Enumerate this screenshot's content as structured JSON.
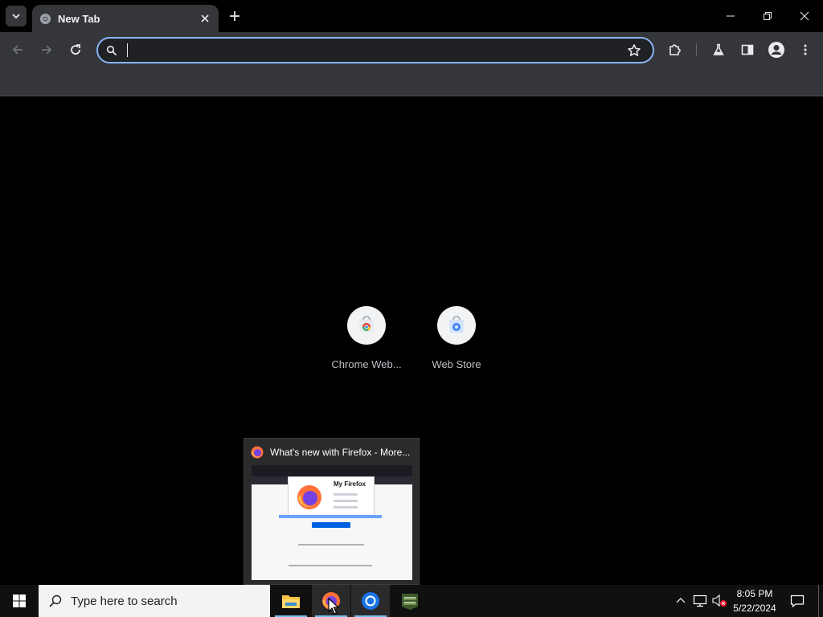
{
  "browser": {
    "tab": {
      "title": "New Tab",
      "favicon": "chrome-favicon"
    },
    "omnibox": {
      "value": "",
      "placeholder": ""
    },
    "colors": {
      "frame": "#000000",
      "toolbar": "#35363a",
      "accent": "#8ab4f8"
    }
  },
  "shortcuts": [
    {
      "label": "Chrome Web...",
      "icon": "chrome-web-store-icon"
    },
    {
      "label": "Web Store",
      "icon": "web-store-icon"
    }
  ],
  "preview": {
    "title": "What's new with Firefox - More...",
    "thumbnail": {
      "heading": "My Firefox"
    }
  },
  "taskbar": {
    "search_placeholder": "Type here to search",
    "apps": [
      "file-explorer",
      "firefox",
      "chrome",
      "beta-craft"
    ],
    "clock": {
      "time": "8:05 PM",
      "date": "5/22/2024"
    }
  }
}
